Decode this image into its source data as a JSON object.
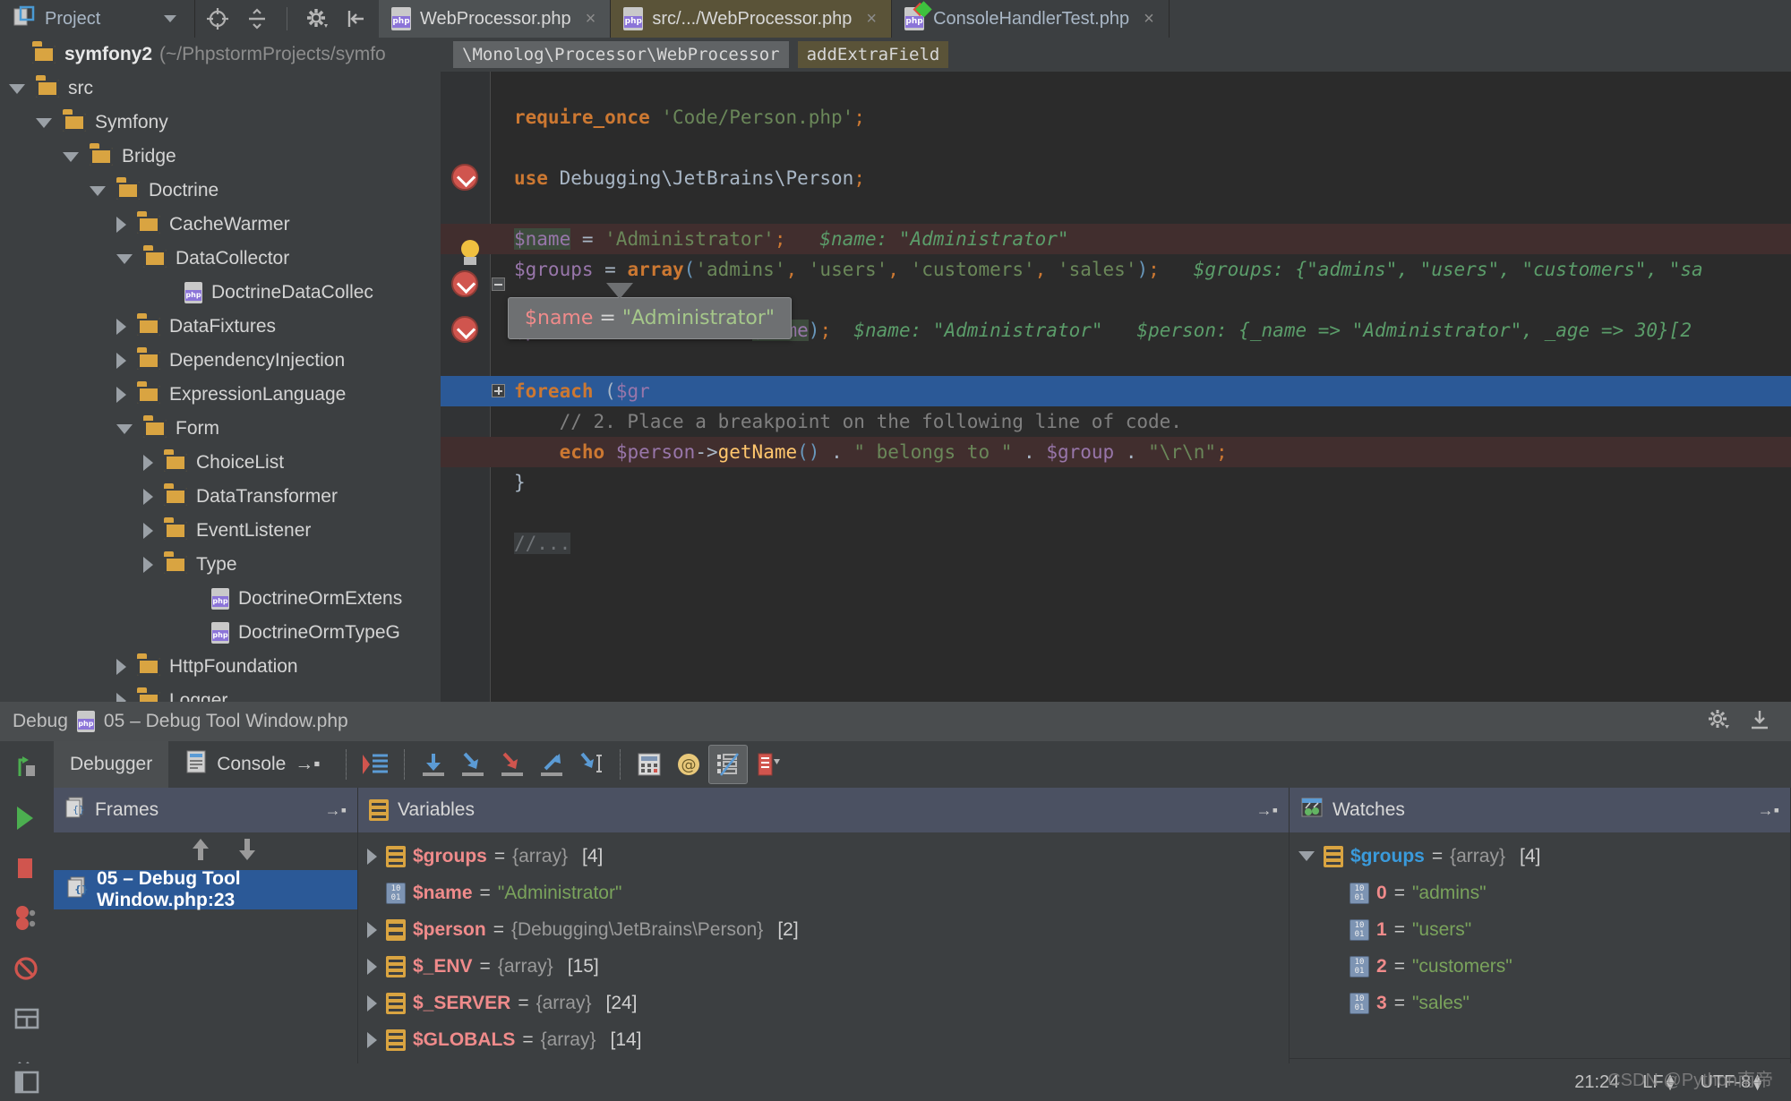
{
  "topbar": {
    "project_label": "Project",
    "icons": [
      "target-icon",
      "collapse-all-icon",
      "gear-icon",
      "hide-panel-icon"
    ],
    "tabs": [
      {
        "label": "WebProcessor.php",
        "icon": "php-file-icon",
        "close": "×",
        "state": "active-gray"
      },
      {
        "label": "src/.../WebProcessor.php",
        "icon": "php-file-icon",
        "close": "×",
        "state": "active-olive"
      },
      {
        "label": "ConsoleHandlerTest.php",
        "icon": "php-test-file-icon",
        "close": "×",
        "state": "plain"
      }
    ]
  },
  "sidebar": {
    "items": [
      {
        "label": "symfony2",
        "path": "(~/PhpstormProjects/symfo",
        "icon": "folder-icon",
        "twisty": "none",
        "indent": 6,
        "bold": true
      },
      {
        "label": "src",
        "icon": "folder-icon",
        "twisty": "down",
        "indent": 10
      },
      {
        "label": "Symfony",
        "icon": "folder-icon",
        "twisty": "down",
        "indent": 40
      },
      {
        "label": "Bridge",
        "icon": "folder-icon",
        "twisty": "down",
        "indent": 70
      },
      {
        "label": "Doctrine",
        "icon": "folder-icon",
        "twisty": "down",
        "indent": 100
      },
      {
        "label": "CacheWarmer",
        "icon": "folder-icon",
        "twisty": "right",
        "indent": 130
      },
      {
        "label": "DataCollector",
        "icon": "folder-icon",
        "twisty": "down",
        "indent": 130
      },
      {
        "label": "DoctrineDataCollec",
        "icon": "php-file-icon",
        "twisty": "none",
        "indent": 176
      },
      {
        "label": "DataFixtures",
        "icon": "folder-icon",
        "twisty": "right",
        "indent": 130
      },
      {
        "label": "DependencyInjection",
        "icon": "folder-icon",
        "twisty": "right",
        "indent": 130
      },
      {
        "label": "ExpressionLanguage",
        "icon": "folder-icon",
        "twisty": "right",
        "indent": 130
      },
      {
        "label": "Form",
        "icon": "folder-icon",
        "twisty": "down",
        "indent": 130
      },
      {
        "label": "ChoiceList",
        "icon": "folder-icon",
        "twisty": "right",
        "indent": 160
      },
      {
        "label": "DataTransformer",
        "icon": "folder-icon",
        "twisty": "right",
        "indent": 160
      },
      {
        "label": "EventListener",
        "icon": "folder-icon",
        "twisty": "right",
        "indent": 160
      },
      {
        "label": "Type",
        "icon": "folder-icon",
        "twisty": "right",
        "indent": 160
      },
      {
        "label": "DoctrineOrmExtens",
        "icon": "php-file-icon",
        "twisty": "none",
        "indent": 206
      },
      {
        "label": "DoctrineOrmTypeG",
        "icon": "php-file-icon",
        "twisty": "none",
        "indent": 206
      },
      {
        "label": "HttpFoundation",
        "icon": "folder-icon",
        "twisty": "right",
        "indent": 130
      },
      {
        "label": "Logger",
        "icon": "folder-icon",
        "twisty": "right",
        "indent": 130
      }
    ]
  },
  "editor": {
    "breadcrumb_namespace": "\\Monolog\\Processor\\WebProcessor",
    "breadcrumb_method": "addExtraField",
    "lines": [
      {
        "id": "l1",
        "kind": "partial",
        "text": ""
      },
      {
        "id": "l2",
        "kind": "code",
        "tokens": [
          {
            "t": "require_once",
            "c": "kw"
          },
          {
            "t": " ",
            "c": "plain"
          },
          {
            "t": "'Code/Person.php'",
            "c": "str"
          },
          {
            "t": ";",
            "c": "punc"
          }
        ]
      },
      {
        "id": "l3",
        "kind": "blank"
      },
      {
        "id": "l4",
        "kind": "code",
        "tokens": [
          {
            "t": "use",
            "c": "kw"
          },
          {
            "t": " Debugging\\JetBrains\\Person",
            "c": "plain"
          },
          {
            "t": ";",
            "c": "punc"
          }
        ]
      },
      {
        "id": "l5",
        "kind": "blank"
      },
      {
        "id": "l6",
        "kind": "code-bp-red",
        "tokens": [
          {
            "t": "$name",
            "c": "var varhl"
          },
          {
            "t": " = ",
            "c": "op"
          },
          {
            "t": "'Administrator'",
            "c": "str"
          },
          {
            "t": ";",
            "c": "punc"
          },
          {
            "t": "   $name: \"Administrator\"",
            "c": "inline"
          }
        ]
      },
      {
        "id": "l7",
        "kind": "code",
        "tokens": [
          {
            "t": "$groups",
            "c": "var"
          },
          {
            "t": " = ",
            "c": "op"
          },
          {
            "t": "array",
            "c": "kw"
          },
          {
            "t": "(",
            "c": "paren"
          },
          {
            "t": "'admins'",
            "c": "str"
          },
          {
            "t": ", ",
            "c": "punc"
          },
          {
            "t": "'users'",
            "c": "str"
          },
          {
            "t": ", ",
            "c": "punc"
          },
          {
            "t": "'customers'",
            "c": "str"
          },
          {
            "t": ", ",
            "c": "punc"
          },
          {
            "t": "'sales'",
            "c": "str"
          },
          {
            "t": ")",
            "c": "paren"
          },
          {
            "t": ";",
            "c": "punc"
          },
          {
            "t": "   $groups: {\"admins\", \"users\", \"customers\", \"sa",
            "c": "inline"
          }
        ]
      },
      {
        "id": "l8",
        "kind": "blank"
      },
      {
        "id": "l9",
        "kind": "code",
        "tokens": [
          {
            "t": "$person",
            "c": "var"
          },
          {
            "t": " = ",
            "c": "op"
          },
          {
            "t": "new",
            "c": "kw"
          },
          {
            "t": " Person",
            "c": "plain"
          },
          {
            "t": "(",
            "c": "paren"
          },
          {
            "t": "$name",
            "c": "var varhl"
          },
          {
            "t": ")",
            "c": "paren"
          },
          {
            "t": ";",
            "c": "punc"
          },
          {
            "t": "  $name: \"Administrator\"   $person: {_name => \"Administrator\", _age => 30}[2",
            "c": "inline"
          }
        ]
      },
      {
        "id": "l10",
        "kind": "blank"
      },
      {
        "id": "l11",
        "kind": "code-bp-blue",
        "tokens": [
          {
            "t": "foreach",
            "c": "kw"
          },
          {
            "t": " (",
            "c": "plain"
          },
          {
            "t": "$gr",
            "c": "var"
          }
        ]
      },
      {
        "id": "l12",
        "kind": "comment",
        "tokens": [
          {
            "t": "    // 2. Place a breakpoint on the following line of code.",
            "c": "cmt"
          }
        ]
      },
      {
        "id": "l13",
        "kind": "code-bp-red",
        "tokens": [
          {
            "t": "    ",
            "c": "plain"
          },
          {
            "t": "echo",
            "c": "kw"
          },
          {
            "t": " ",
            "c": "plain"
          },
          {
            "t": "$person",
            "c": "var"
          },
          {
            "t": "->",
            "c": "op"
          },
          {
            "t": "getName",
            "c": "fn"
          },
          {
            "t": "()",
            "c": "paren"
          },
          {
            "t": " . ",
            "c": "op"
          },
          {
            "t": "\" belongs to \"",
            "c": "str"
          },
          {
            "t": " . ",
            "c": "op"
          },
          {
            "t": "$group",
            "c": "var"
          },
          {
            "t": " . ",
            "c": "op"
          },
          {
            "t": "\"\\r\\n\"",
            "c": "str"
          },
          {
            "t": ";",
            "c": "punc"
          }
        ]
      },
      {
        "id": "l14",
        "kind": "code",
        "tokens": [
          {
            "t": "}",
            "c": "plain"
          }
        ]
      },
      {
        "id": "l15",
        "kind": "blank"
      },
      {
        "id": "l16",
        "kind": "folded",
        "tokens": [
          {
            "t": "//...",
            "c": "folded"
          }
        ]
      }
    ],
    "tooltip": {
      "var": "$name",
      "eq": " = ",
      "value": "\"Administrator\""
    }
  },
  "debug": {
    "title": "Debug",
    "session_file": "05 – Debug Tool Window.php",
    "tabs": [
      {
        "label": "Debugger",
        "selected": true
      },
      {
        "label": "Console",
        "selected": false
      }
    ],
    "toolbar_buttons": [
      "rerun-icon",
      "show-execution-point-icon",
      "step-over-icon",
      "step-into-icon",
      "force-step-into-icon",
      "step-out-icon",
      "run-to-cursor-icon",
      "evaluate-expression-icon",
      "at-icon",
      "show-values-inline-icon",
      "settings-icon"
    ],
    "left_rail": [
      "rerun-icon",
      "resume-icon",
      "stop-icon",
      "view-breakpoints-icon",
      "mute-breakpoints-icon",
      "layout-icon",
      "expand-icon"
    ],
    "frames": {
      "title": "Frames",
      "items": [
        {
          "label": "05 – Debug Tool Window.php:23",
          "selected": true
        }
      ]
    },
    "variables": {
      "title": "Variables",
      "items": [
        {
          "twisty": "closed",
          "icon": "array-icon",
          "name": "$groups",
          "eq": " = ",
          "type": "{array}",
          "count": "[4]"
        },
        {
          "twisty": "none",
          "icon": "string-icon",
          "name": "$name",
          "eq": " = ",
          "value": "\"Administrator\""
        },
        {
          "twisty": "closed",
          "icon": "object-icon",
          "name": "$person",
          "eq": " = ",
          "type": "{Debugging\\JetBrains\\Person}",
          "count": "[2]"
        },
        {
          "twisty": "closed",
          "icon": "array-icon",
          "name": "$_ENV",
          "eq": " = ",
          "type": "{array}",
          "count": "[15]"
        },
        {
          "twisty": "closed",
          "icon": "array-icon",
          "name": "$_SERVER",
          "eq": " = ",
          "type": "{array}",
          "count": "[24]"
        },
        {
          "twisty": "closed",
          "icon": "array-icon",
          "name": "$GLOBALS",
          "eq": " = ",
          "type": "{array}",
          "count": "[14]"
        }
      ]
    },
    "watches": {
      "title": "Watches",
      "items": [
        {
          "twisty": "open",
          "icon": "array-icon",
          "name": "$groups",
          "eq": " = ",
          "type": "{array}",
          "count": "[4]",
          "indent": 0,
          "blue": true
        },
        {
          "twisty": "none",
          "icon": "string-icon",
          "name": "0",
          "eq": " = ",
          "value": "\"admins\"",
          "indent": 36
        },
        {
          "twisty": "none",
          "icon": "string-icon",
          "name": "1",
          "eq": " = ",
          "value": "\"users\"",
          "indent": 36
        },
        {
          "twisty": "none",
          "icon": "string-icon",
          "name": "2",
          "eq": " = ",
          "value": "\"customers\"",
          "indent": 36
        },
        {
          "twisty": "none",
          "icon": "string-icon",
          "name": "3",
          "eq": " = ",
          "value": "\"sales\"",
          "indent": 36
        }
      ],
      "toolbar": [
        "add-watch-icon",
        "remove-watch-icon",
        "move-up-icon",
        "move-down-icon",
        "duplicate-icon"
      ]
    }
  },
  "statusbar": {
    "time": "21:24",
    "line_separator": "LF",
    "encoding": "UTF-8",
    "watermark": "CSDN @Python南帝"
  },
  "colors": {
    "accent_blue": "#2b5997",
    "breakpoint_red": "#d0554e",
    "folder_gold": "#d9a441",
    "string_green": "#6a8759",
    "keyword_orange": "#cc7832",
    "variable_purple": "#9876aa",
    "inline_value_green": "#5b9d6a",
    "panel_header_blue": "#4b5162"
  }
}
